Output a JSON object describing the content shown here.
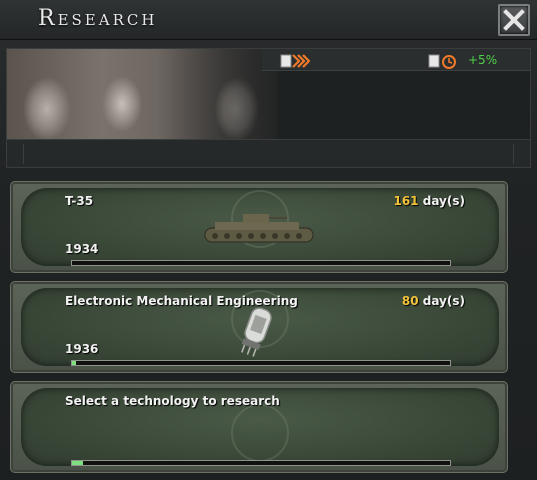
{
  "window": {
    "title": "Research",
    "close_label": "Close"
  },
  "header": {
    "bonus": "+5%"
  },
  "slots": [
    {
      "name": "T-35",
      "days": "161",
      "days_unit": "day(s)",
      "year": "1934",
      "progress": 0.0
    },
    {
      "name": "Electronic Mechanical Engineering",
      "days": "80",
      "days_unit": "day(s)",
      "year": "1936",
      "progress": 0.01
    },
    {
      "name": "Select a technology to research",
      "progress": 0.03
    }
  ],
  "colors": {
    "days": "#f2c33a",
    "bonus": "#4fd14a",
    "progress": "#7fe07f"
  },
  "icons": [
    "close-icon",
    "research-speed-icon",
    "research-bonus-icon",
    "tank-icon",
    "vacuum-tube-icon",
    "wreath-emblem-icon"
  ]
}
